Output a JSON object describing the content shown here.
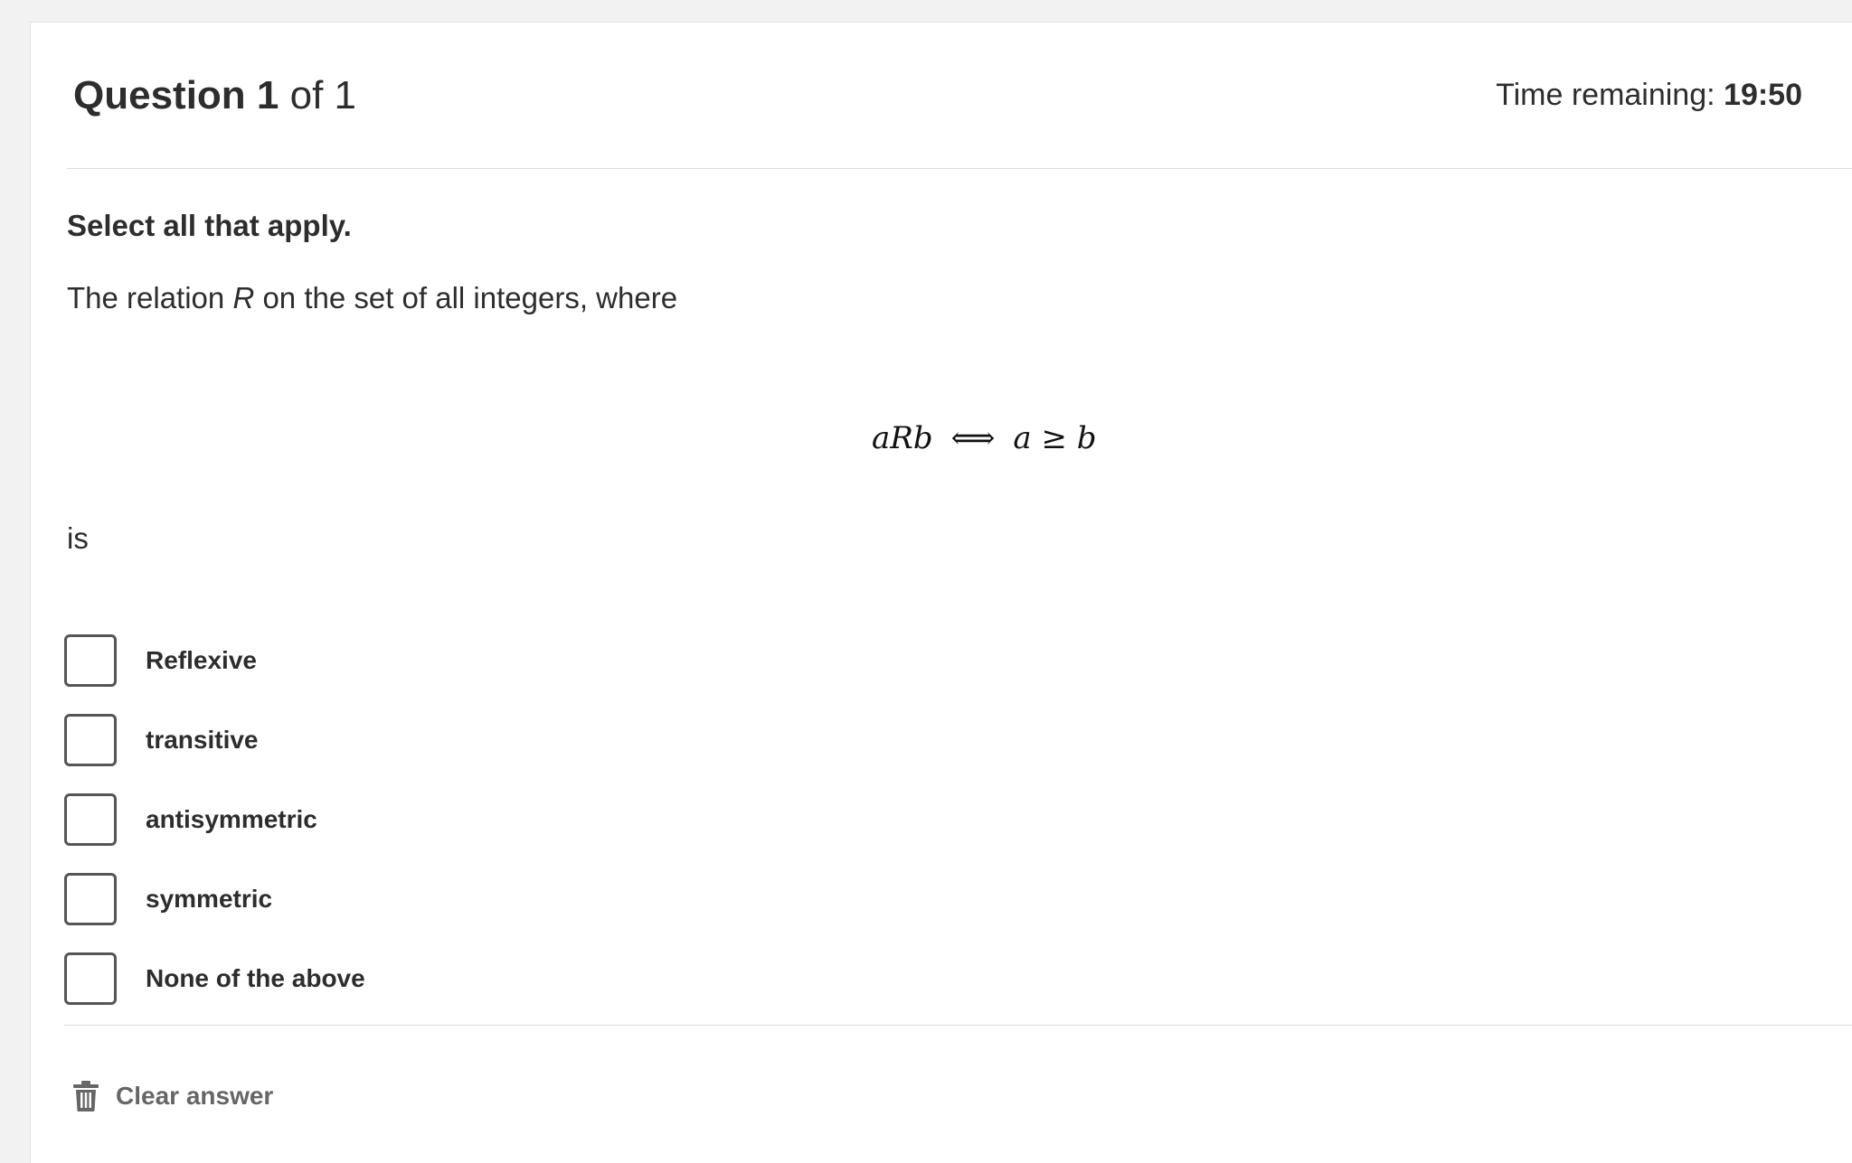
{
  "header": {
    "question_word": "Question",
    "question_number": "1",
    "of_label": "of 1",
    "timer_label": "Time remaining:",
    "timer_value": "19:50"
  },
  "question": {
    "instruction": "Select all that apply.",
    "prompt_before": "The relation ",
    "prompt_var": "R",
    "prompt_after": " on the set of all integers, where",
    "math": {
      "lhs": "aRb",
      "operator": "⟺",
      "rhs": "a ≥ b"
    },
    "tail": "is"
  },
  "options": [
    {
      "label": "Reflexive",
      "checked": false
    },
    {
      "label": "transitive",
      "checked": false
    },
    {
      "label": "antisymmetric",
      "checked": false
    },
    {
      "label": "symmetric",
      "checked": false
    },
    {
      "label": "None of the above",
      "checked": false
    }
  ],
  "footer": {
    "clear_label": "Clear answer",
    "clear_icon": "trash-icon"
  },
  "colors": {
    "page_bg": "#f2f2f2",
    "card_bg": "#ffffff",
    "text": "#2d2d2d",
    "checkbox_border": "#555555",
    "muted": "#666666"
  }
}
